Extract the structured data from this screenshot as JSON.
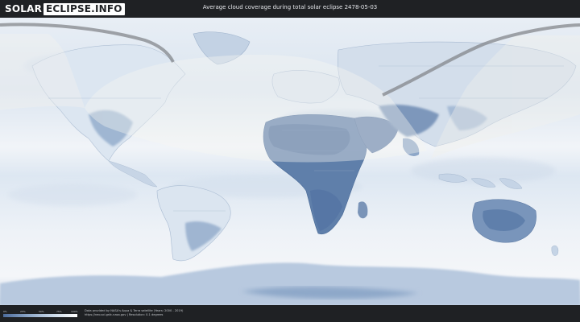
{
  "header": {
    "logo_part1": "SOLAR",
    "logo_part2": "ECLIPSE.INFO",
    "title": "Average cloud coverage during total solar eclipse 2478-05-03"
  },
  "map": {
    "ocean_color": "#dfe8f2",
    "land_cloudy_color": "#e3ebf4",
    "land_clear_color": "#4f6f9e",
    "eclipse_path_color": "#7a7d82",
    "night_overlay_color": "#f2f2f0",
    "regions": {
      "north_america": "North America",
      "south_america": "South America",
      "africa": "Africa",
      "europe": "Europe",
      "asia": "Asia",
      "australia": "Australia",
      "antarctica": "Antarctica"
    }
  },
  "footer": {
    "scale_ticks": [
      "0%",
      "25%",
      "50%",
      "75%",
      "100%"
    ],
    "credit_line1": "Data provided by NASA's Aqua & Terra satellite (Years: 2000 - 2019)",
    "credit_line2": "https://neo.sci.gsfc.nasa.gov | Resolution: 0.1 degrees"
  }
}
